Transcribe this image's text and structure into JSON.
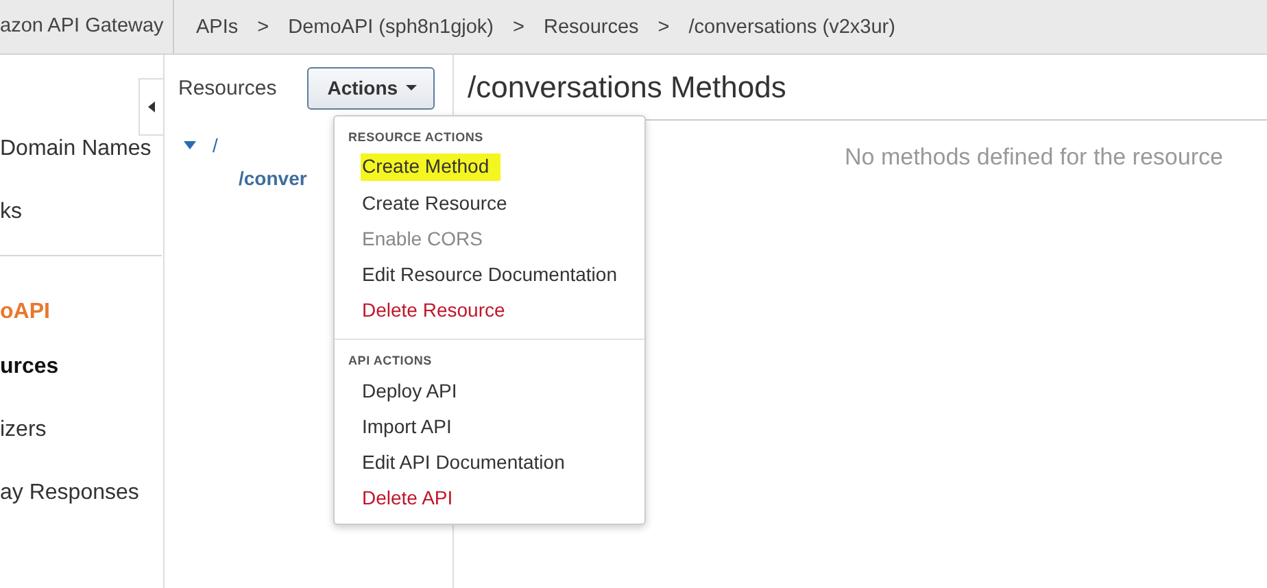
{
  "top_bar": {
    "service": "azon API Gateway",
    "breadcrumbs": [
      {
        "label": "APIs"
      },
      {
        "label": "DemoAPI (sph8n1gjok)"
      },
      {
        "label": "Resources"
      },
      {
        "label": "/conversations (v2x3ur)"
      }
    ],
    "separator": ">"
  },
  "sidebar": {
    "items": [
      {
        "label": "Domain Names",
        "kind": "plain",
        "selected": false
      },
      {
        "label": "ks",
        "kind": "plain",
        "selected": false
      },
      {
        "kind": "divider"
      },
      {
        "label": "oAPI",
        "kind": "api",
        "selected": false
      },
      {
        "label": "urces",
        "kind": "plain",
        "selected": true
      },
      {
        "label": "izers",
        "kind": "plain",
        "selected": false
      },
      {
        "label": "ay Responses",
        "kind": "plain",
        "selected": false
      }
    ]
  },
  "resources_panel": {
    "title": "Resources",
    "actions_button": "Actions",
    "tree": [
      {
        "label": "/",
        "expanded": true,
        "children": [
          {
            "label": "/conver"
          }
        ]
      }
    ]
  },
  "main": {
    "title": "/conversations Methods",
    "empty_message": "No methods defined for the resource"
  },
  "actions_menu": {
    "sections": [
      {
        "heading": "RESOURCE ACTIONS",
        "items": [
          {
            "label": "Create Method",
            "kind": "normal",
            "highlighted": true
          },
          {
            "label": "Create Resource",
            "kind": "normal",
            "highlighted": false
          },
          {
            "label": "Enable CORS",
            "kind": "disabled",
            "highlighted": false
          },
          {
            "label": "Edit Resource Documentation",
            "kind": "normal",
            "highlighted": false
          },
          {
            "label": "Delete Resource",
            "kind": "danger",
            "highlighted": false
          }
        ]
      },
      {
        "heading": "API ACTIONS",
        "items": [
          {
            "label": "Deploy API",
            "kind": "normal",
            "highlighted": false
          },
          {
            "label": "Import API",
            "kind": "normal",
            "highlighted": false
          },
          {
            "label": "Edit API Documentation",
            "kind": "normal",
            "highlighted": false
          },
          {
            "label": "Delete API",
            "kind": "danger",
            "highlighted": false
          }
        ]
      }
    ]
  }
}
